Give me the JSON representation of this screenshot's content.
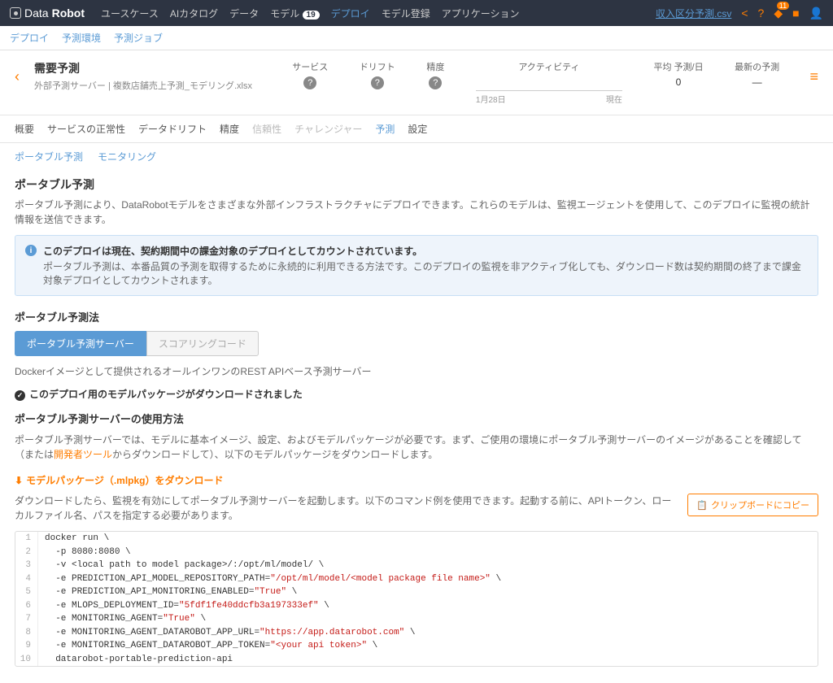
{
  "brand": {
    "p1": "Data",
    "p2": "Robot"
  },
  "topnav": {
    "items": [
      "ユースケース",
      "AIカタログ",
      "データ",
      "モデル",
      "デプロイ",
      "モデル登録",
      "アプリケーション"
    ],
    "model_badge": "19",
    "file_link": "収入区分予測.csv"
  },
  "subnav": [
    "デプロイ",
    "予測環境",
    "予測ジョブ"
  ],
  "header": {
    "title": "需要予測",
    "subtitle": "外部予測サーバー | 複数店舗売上予測_モデリング.xlsx",
    "stats": {
      "service": "サービス",
      "drift": "ドリフト",
      "accuracy": "精度",
      "activity": "アクティビティ",
      "act_start": "1月28日",
      "act_end": "現在",
      "avg": "平均 予測/日",
      "avg_val": "0",
      "latest": "最新の予測",
      "latest_val": "—"
    }
  },
  "tabs": [
    "概要",
    "サービスの正常性",
    "データドリフト",
    "精度",
    "信頼性",
    "チャレンジャー",
    "予測",
    "設定"
  ],
  "subtabs": [
    "ポータブル予測",
    "モニタリング"
  ],
  "page": {
    "title": "ポータブル予測",
    "intro": "ポータブル予測により、DataRobotモデルをさまざまな外部インフラストラクチャにデプロイできます。これらのモデルは、監視エージェントを使用して、このデプロイに監視の統計情報を送信できます。",
    "alert_title": "このデプロイは現在、契約期間中の課金対象のデプロイとしてカウントされています。",
    "alert_desc": "ポータブル予測は、本番品質の予測を取得するために永続的に利用できる方法です。このデプロイの監視を非アクティブ化しても、ダウンロード数は契約期間の終了まで課金対象デプロイとしてカウントされます。",
    "method_title": "ポータブル予測法",
    "btn1": "ポータブル予測サーバー",
    "btn2": "スコアリングコード",
    "docker_desc": "Dockerイメージとして提供されるオールインワンのREST APIベース予測サーバー",
    "downloaded": "このデプロイ用のモデルパッケージがダウンロードされました",
    "usage_title": "ポータブル予測サーバーの使用方法",
    "usage_desc1": "ポータブル予測サーバーでは、モデルに基本イメージ、設定、およびモデルパッケージが必要です。まず、ご使用の環境にポータブル予測サーバーのイメージがあることを確認して（または",
    "dev_tool": "開発者ツール",
    "usage_desc2": "からダウンロードして）、以下のモデルパッケージをダウンロードします。",
    "dl_label": "モデルパッケージ（.mlpkg）をダウンロード",
    "cmd_desc": "ダウンロードしたら、監視を有効にしてポータブル予測サーバーを起動します。以下のコマンド例を使用できます。起動する前に、APIトークン、ローカルファイル名、パスを指定する必要があります。",
    "copy": "クリップボードにコピー"
  },
  "code": [
    {
      "n": "1",
      "pre": "docker run \\",
      "str": ""
    },
    {
      "n": "2",
      "pre": "  -p 8080:8080 \\",
      "str": ""
    },
    {
      "n": "3",
      "pre": "  -v <local path to model package>/:/opt/ml/model/ \\",
      "str": ""
    },
    {
      "n": "4",
      "pre": "  -e PREDICTION_API_MODEL_REPOSITORY_PATH=",
      "str": "\"/opt/ml/model/<model package file name>\"",
      "post": " \\"
    },
    {
      "n": "5",
      "pre": "  -e PREDICTION_API_MONITORING_ENABLED=",
      "str": "\"True\"",
      "post": " \\"
    },
    {
      "n": "6",
      "pre": "  -e MLOPS_DEPLOYMENT_ID=",
      "str": "\"5fdf1fe40ddcfb3a197333ef\"",
      "post": " \\"
    },
    {
      "n": "7",
      "pre": "  -e MONITORING_AGENT=",
      "str": "\"True\"",
      "post": " \\"
    },
    {
      "n": "8",
      "pre": "  -e MONITORING_AGENT_DATAROBOT_APP_URL=",
      "str": "\"https://app.datarobot.com\"",
      "post": " \\"
    },
    {
      "n": "9",
      "pre": "  -e MONITORING_AGENT_DATAROBOT_APP_TOKEN=",
      "str": "\"<your api token>\"",
      "post": " \\"
    },
    {
      "n": "10",
      "pre": "  datarobot-portable-prediction-api",
      "str": ""
    }
  ]
}
